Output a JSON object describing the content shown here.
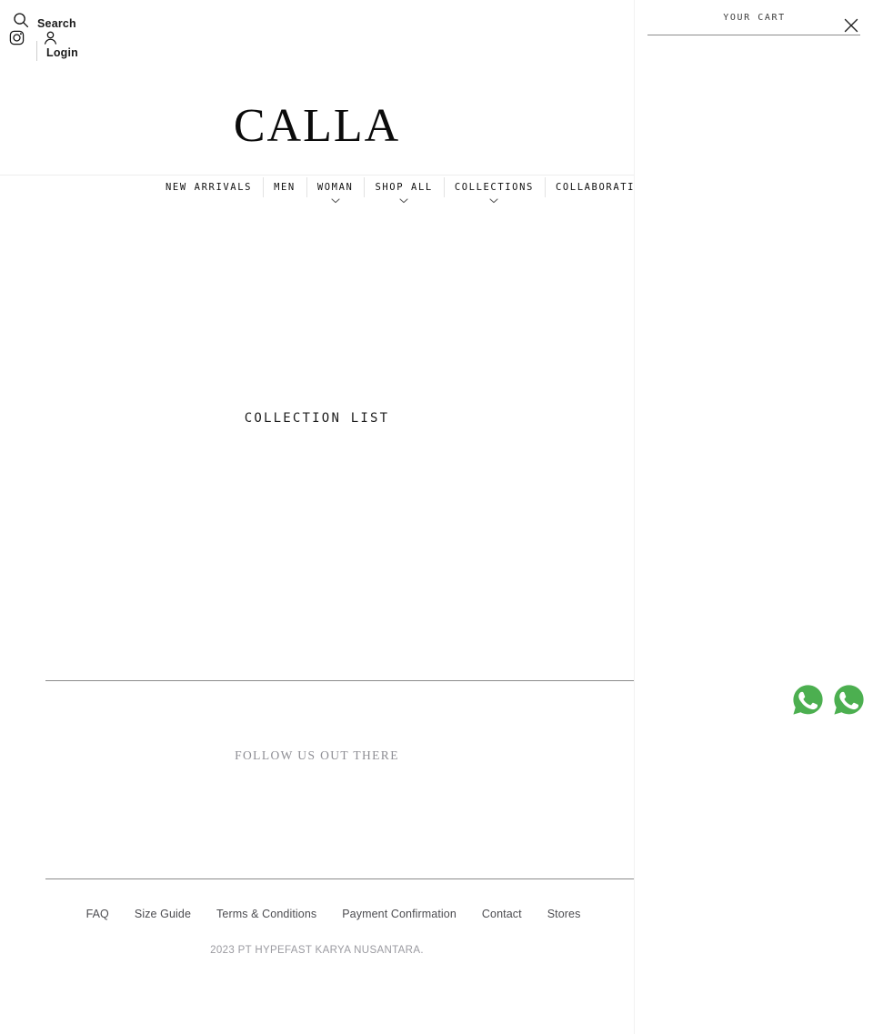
{
  "brand": {
    "logo_text": "CALLA"
  },
  "utility": {
    "search_label": "Search",
    "login_label": "Login",
    "search_icon": "search-icon",
    "instagram_icon": "instagram-icon",
    "account_icon": "account-icon"
  },
  "nav": {
    "items": [
      {
        "label": "NEW ARRIVALS",
        "has_caret": false
      },
      {
        "label": "MEN",
        "has_caret": false
      },
      {
        "label": "WOMAN",
        "has_caret": true
      },
      {
        "label": "SHOP ALL",
        "has_caret": true
      },
      {
        "label": "COLLECTIONS",
        "has_caret": true
      },
      {
        "label": "COLLABORATI",
        "has_caret": false
      }
    ]
  },
  "main": {
    "collection_list_heading": "COLLECTION LIST",
    "follow_us_heading": "FOLLOW US OUT THERE"
  },
  "footer": {
    "links": [
      {
        "label": "FAQ"
      },
      {
        "label": "Size Guide"
      },
      {
        "label": "Terms & Conditions"
      },
      {
        "label": "Payment Confirmation"
      },
      {
        "label": "Contact"
      },
      {
        "label": "Stores"
      }
    ],
    "copyright": "2023 PT HYPEFAST KARYA NUSANTARA."
  },
  "cart": {
    "title": "YOUR CART",
    "close_icon": "close-icon"
  },
  "floating": {
    "whatsapp_1_icon": "whatsapp-icon",
    "whatsapp_2_icon": "whatsapp-icon"
  },
  "colors": {
    "text_primary": "#121212",
    "text_muted": "#8e8e94",
    "divider": "#8b8b8b",
    "whatsapp_green": "#4caf50"
  }
}
